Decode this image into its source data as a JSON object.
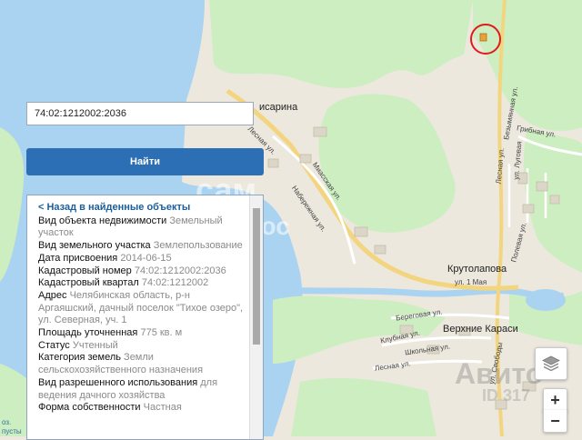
{
  "search": {
    "value": "74:02:1212002:2036"
  },
  "find_button": {
    "label": "Найти"
  },
  "info": {
    "back_link": "< Назад в найденные объекты",
    "rows": [
      {
        "label": "Вид объекта недвижимости",
        "value": "Земельный участок"
      },
      {
        "label": "Вид земельного участка",
        "value": "Землепользование"
      },
      {
        "label": "Дата присвоения",
        "value": "2014-06-15"
      },
      {
        "label": "Кадастровый номер",
        "value": "74:02:1212002:2036"
      },
      {
        "label": "Кадастровый квартал",
        "value": "74:02:1212002"
      },
      {
        "label": "Адрес",
        "value": "Челябинская область, р-н Аргаяшский, дачный поселок \"Тихое озеро\", ул. Северная, уч. 1"
      },
      {
        "label": "Площадь уточненная",
        "value": "775 кв. м"
      },
      {
        "label": "Статус",
        "value": "Учтенный"
      },
      {
        "label": "Категория земель",
        "value": "Земли сельскохозяйственного назначения"
      },
      {
        "label": "Вид разрешенного использования",
        "value": "для ведения дачного хозяйства"
      },
      {
        "label": "Форма собственности",
        "value": "Частная"
      }
    ]
  },
  "map": {
    "labels": {
      "town_kisarina": "исарина",
      "town_krutolapova": "Крутолапова",
      "town_verkhnie_karasi": "Верхние Караси",
      "street_lesnaya_1": "Лесная ул.",
      "street_miasskaya": "Миасская ул.",
      "street_naberezhnaya": "Набережная ул.",
      "street_bezymyannaya": "Безымянная ул.",
      "street_gribnaya": "Грибная ул.",
      "street_lesnaya_2": "Лесная ул.",
      "street_lugovaya": "ул. Луговая",
      "street_polevaya": "Полевая ул.",
      "street_1_maya": "ул. 1 Мая",
      "street_beregovaya": "Береговая ул.",
      "street_klubnaya": "Клубная ул.",
      "street_shkolnaya": "Школьная ул.",
      "street_lesnaya_3": "Лесная ул.",
      "street_svobody": "ул. Свободы",
      "edge_oz": "оз.",
      "edge_bottom": "пусты"
    },
    "watermarks": {
      "top": "сам",
      "plus": "плюс",
      "id": "ID 317",
      "avito": "Авито"
    },
    "colors": {
      "water": "#a9d3f0",
      "forest": "#cdeec0",
      "land": "#ece8de",
      "road": "#f3d57f",
      "highlight": "#e01b1b"
    }
  },
  "controls": {
    "zoom_in": "+",
    "zoom_out": "−"
  }
}
